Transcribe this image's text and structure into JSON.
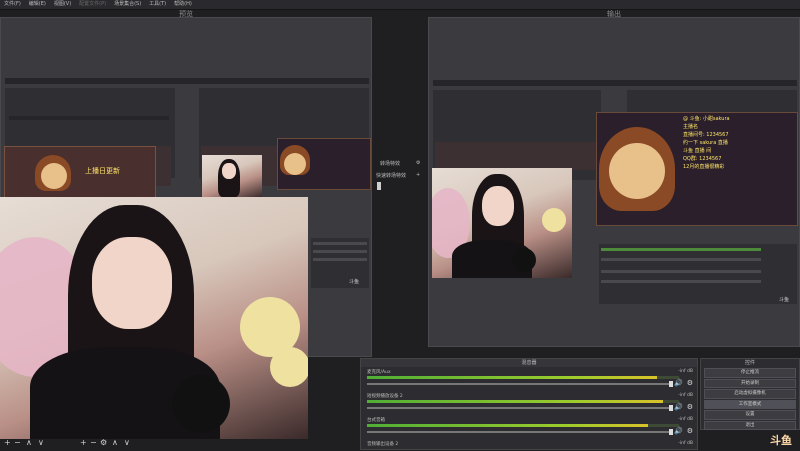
{
  "menu": [
    {
      "label": "文件(F)",
      "enabled": true
    },
    {
      "label": "编辑(E)",
      "enabled": true
    },
    {
      "label": "视图(V)",
      "enabled": true
    },
    {
      "label": "配置文件(P)",
      "enabled": false
    },
    {
      "label": "场景集合(S)",
      "enabled": true
    },
    {
      "label": "工具(T)",
      "enabled": true
    },
    {
      "label": "帮助(H)",
      "enabled": true
    }
  ],
  "preview": {
    "title": "预览"
  },
  "program": {
    "title": "输出"
  },
  "transitions": {
    "transition_label": "转场特效",
    "quick_label": "快速转场特效",
    "add": "+"
  },
  "overlay": {
    "lines": [
      "@ 斗鱼: 小甜sakura",
      "主播名",
      "直播间号: 1234567",
      "约一下 sakura 直播",
      "斗鱼 直播 间",
      "QQ群: 1234567",
      "12月的直播很精彩"
    ],
    "left_banner": "上播日更新"
  },
  "mixer": {
    "title": "混音器",
    "tracks": [
      {
        "name": "麦克风/Aux",
        "db": "-inf dB",
        "level": 0.93
      },
      {
        "name": "短视频播放设备 2",
        "db": "-inf dB",
        "level": 0.95
      },
      {
        "name": "台式音箱",
        "db": "-inf dB",
        "level": 0.9
      },
      {
        "name": "音频输出设备 2",
        "db": "-inf dB",
        "level": 0.0
      }
    ]
  },
  "controls": {
    "title": "控件",
    "buttons": [
      "停止推流",
      "开始录制",
      "启动虚拟摄像机",
      "工作室模式",
      "设置",
      "退出"
    ],
    "selected_index": 3
  },
  "toolbar": {
    "add": "+",
    "remove": "−",
    "up": "∧",
    "down": "∨",
    "gear": "⚙"
  },
  "watermark": {
    "text": "斗鱼"
  },
  "icons": {
    "volume": "speaker-icon",
    "settings": "gear-icon"
  }
}
